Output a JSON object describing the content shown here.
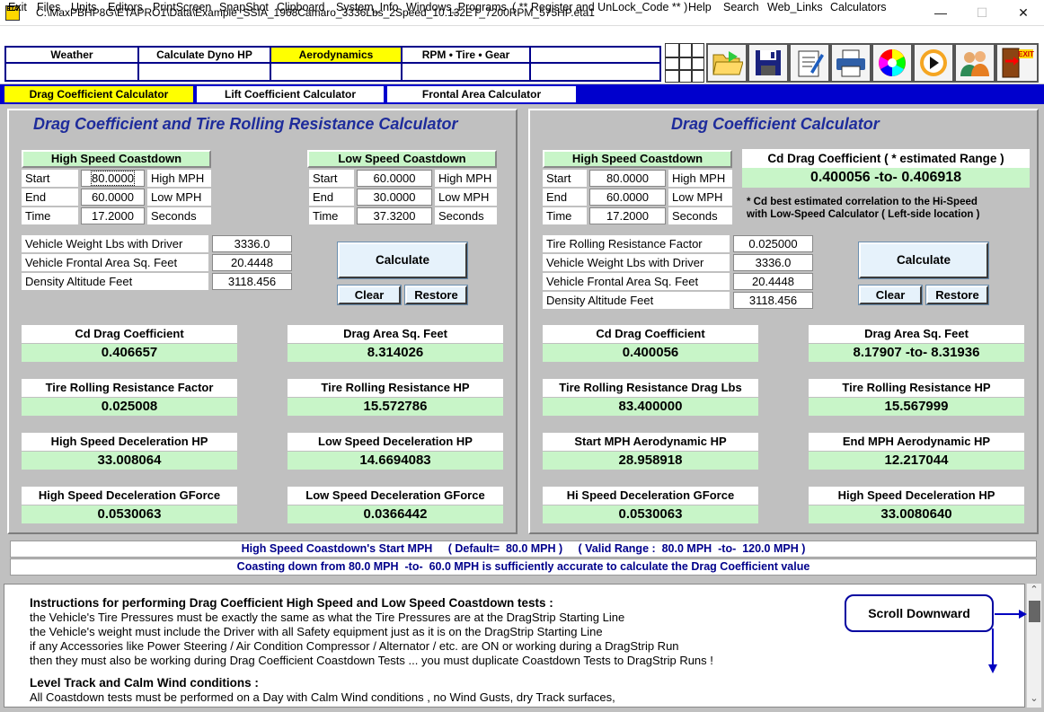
{
  "window": {
    "icon_text": "ETA",
    "title": "C:\\MaxPBHP8G\\ETAPRO1\\Data\\Example_SSIA_1968Camaro_3336Lbs_2Speed_10.132ET_7200RPM_575HP.eta1",
    "min": "—",
    "max": "☐",
    "close": "✕"
  },
  "menu": [
    "Exit",
    "Files",
    "Units",
    "Editors",
    "PrintScreen",
    "SnapShot",
    "Clipboard",
    "System_Info",
    "Windows_Programs",
    "( ** Register and UnLock_Code ** )",
    "Help",
    "Search",
    "Web_Links",
    "Calculators"
  ],
  "toptabs": [
    "Weather",
    "Calculate Dyno HP",
    "Aerodynamics",
    "RPM  •  Tire  •  Gear",
    ""
  ],
  "toolbar_icons": [
    "open-folder-icon",
    "save-disk-icon",
    "edit-notepad-icon",
    "print-icon",
    "color-wheel-icon",
    "play-icon",
    "users-icon",
    "exit-door-icon"
  ],
  "toolbar_exit_text": "EXIT",
  "subtabs": [
    "Drag Coefficient Calculator",
    "Lift Coefficient Calculator",
    "Frontal Area Calculator"
  ],
  "colors": {
    "accent_blue": "#0000cd",
    "tab_yellow": "#ffff00",
    "value_green": "#c8f5c8",
    "title_blue": "#1e2c9b"
  },
  "left": {
    "title": "Drag  Coefficient  and  Tire  Rolling  Resistance  Calculator",
    "hs": {
      "header": "High Speed Coastdown",
      "rows": [
        {
          "label": "Start",
          "value": "80.0000",
          "unit": "High MPH"
        },
        {
          "label": "End",
          "value": "60.0000",
          "unit": "Low MPH"
        },
        {
          "label": "Time",
          "value": "17.2000",
          "unit": "Seconds"
        }
      ]
    },
    "ls": {
      "header": "Low Speed Coastdown",
      "rows": [
        {
          "label": "Start",
          "value": "60.0000",
          "unit": "High MPH"
        },
        {
          "label": "End",
          "value": "30.0000",
          "unit": "Low MPH"
        },
        {
          "label": "Time",
          "value": "37.3200",
          "unit": "Seconds"
        }
      ]
    },
    "vehicle": [
      {
        "label": "Vehicle Weight Lbs with Driver",
        "value": "3336.0"
      },
      {
        "label": "Vehicle Frontal Area Sq. Feet",
        "value": "20.4448"
      },
      {
        "label": "Density Altitude Feet",
        "value": "3118.456"
      }
    ],
    "calc": "Calculate",
    "clear": "Clear",
    "restore": "Restore",
    "results": [
      {
        "label": "Cd  Drag Coefficient",
        "value": "0.406657"
      },
      {
        "label": "Drag Area Sq. Feet",
        "value": "8.314026"
      },
      {
        "label": "Tire Rolling Resistance Factor",
        "value": "0.025008"
      },
      {
        "label": "Tire Rolling Resistance HP",
        "value": "15.572786"
      },
      {
        "label": "High Speed Deceleration HP",
        "value": "33.008064"
      },
      {
        "label": "Low Speed Deceleration HP",
        "value": "14.6694083"
      },
      {
        "label": "High Speed Deceleration GForce",
        "value": "0.0530063"
      },
      {
        "label": "Low Speed Deceleration GForce",
        "value": "0.0366442"
      }
    ]
  },
  "right": {
    "title": "Drag  Coefficient  Calculator",
    "hs": {
      "header": "High Speed Coastdown",
      "rows": [
        {
          "label": "Start",
          "value": "80.0000",
          "unit": "High MPH"
        },
        {
          "label": "End",
          "value": "60.0000",
          "unit": "Low MPH"
        },
        {
          "label": "Time",
          "value": "17.2000",
          "unit": "Seconds"
        }
      ]
    },
    "cd_header": "Cd Drag Coefficient   ( * estimated Range )",
    "cd_range": "0.400056   -to-   0.406918",
    "note1": "* Cd best estimated correlation to the Hi-Speed",
    "note2": "with Low-Speed Calculator ( Left-side location )",
    "vehicle": [
      {
        "label": "Tire Rolling Resistance Factor",
        "value": "0.025000"
      },
      {
        "label": "Vehicle Weight Lbs with Driver",
        "value": "3336.0"
      },
      {
        "label": "Vehicle Frontal Area Sq. Feet",
        "value": "20.4448"
      },
      {
        "label": "Density Altitude Feet",
        "value": "3118.456"
      }
    ],
    "calc": "Calculate",
    "clear": "Clear",
    "restore": "Restore",
    "results": [
      {
        "label": "Cd  Drag Coefficient",
        "value": "0.400056"
      },
      {
        "label": "Drag Area Sq. Feet",
        "value": "8.17907  -to-  8.31936"
      },
      {
        "label": "Tire Rolling Resistance Drag Lbs",
        "value": "83.400000"
      },
      {
        "label": "Tire Rolling Resistance HP",
        "value": "15.567999"
      },
      {
        "label": "Start MPH Aerodynamic HP",
        "value": "28.958918"
      },
      {
        "label": "End  MPH Aerodynamic HP",
        "value": "12.217044"
      },
      {
        "label": "Hi Speed Deceleration GForce",
        "value": "0.0530063"
      },
      {
        "label": "High Speed Deceleration HP",
        "value": "33.0080640"
      }
    ]
  },
  "status": {
    "line1": "High Speed Coastdown's Start MPH     ( Default=  80.0 MPH )     ( Valid Range :  80.0 MPH  -to-  120.0 MPH )",
    "line2": "Coasting down from 80.0 MPH  -to-  60.0 MPH is sufficiently accurate to calculate the Drag Coefficient value"
  },
  "instructions": [
    {
      "bold": true,
      "text": "Instructions for performing Drag Coefficient High Speed and Low Speed Coastdown tests :"
    },
    {
      "bold": false,
      "text": "the Vehicle's Tire Pressures must be exactly the same as what the Tire Pressures are at the DragStrip Starting Line"
    },
    {
      "bold": false,
      "text": "the Vehicle's weight must include the Driver with all Safety equipment just as it is on the DragStrip Starting Line"
    },
    {
      "bold": false,
      "text": "if any Accessories like Power Steering / Air Condition Compressor / Alternator / etc. are ON or working during a DragStrip Run"
    },
    {
      "bold": false,
      "text": "then they must also be working during Drag Coefficient Coastdown Tests ... you must duplicate Coastdown Tests to DragStrip Runs !"
    },
    {
      "bold": true,
      "text": "Level Track and Calm Wind conditions :"
    },
    {
      "bold": false,
      "text": "All Coastdown tests must be performed on a Day with Calm Wind conditions , no Wind Gusts, dry Track surfaces,"
    }
  ],
  "callout": "Scroll Downward",
  "scroll": {
    "up": "⌃",
    "down": "⌄"
  }
}
